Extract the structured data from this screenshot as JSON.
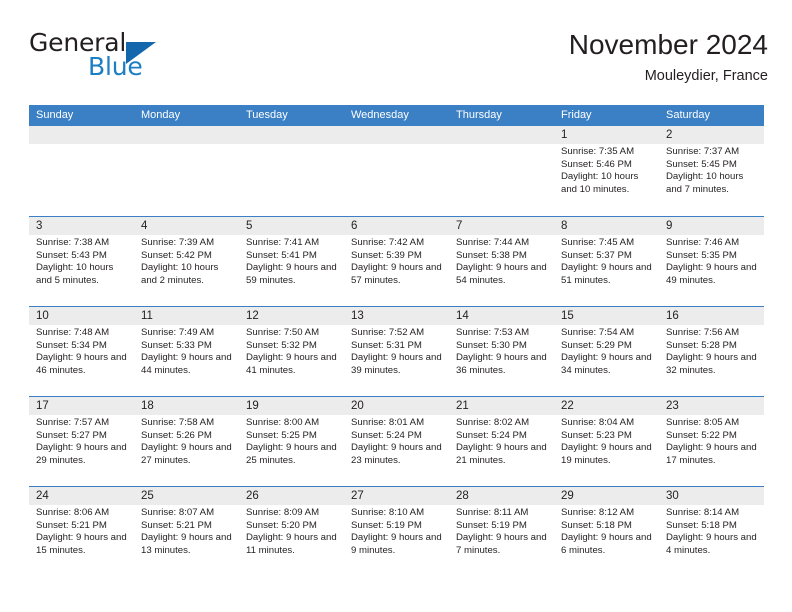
{
  "brand": {
    "name_part1": "General",
    "name_part2": "Blue",
    "accent_color": "#1c7fc4",
    "triangle_color": "#1567ad"
  },
  "header": {
    "title": "November 2024",
    "location": "Mouleydier, France"
  },
  "calendar": {
    "header_color": "#3b7fc4",
    "day_band_color": "#ececec",
    "weekdays": [
      "Sunday",
      "Monday",
      "Tuesday",
      "Wednesday",
      "Thursday",
      "Friday",
      "Saturday"
    ],
    "weeks": [
      [
        {
          "day": "",
          "empty": true
        },
        {
          "day": "",
          "empty": true
        },
        {
          "day": "",
          "empty": true
        },
        {
          "day": "",
          "empty": true
        },
        {
          "day": "",
          "empty": true
        },
        {
          "day": "1",
          "sunrise": "Sunrise: 7:35 AM",
          "sunset": "Sunset: 5:46 PM",
          "daylight": "Daylight: 10 hours and 10 minutes."
        },
        {
          "day": "2",
          "sunrise": "Sunrise: 7:37 AM",
          "sunset": "Sunset: 5:45 PM",
          "daylight": "Daylight: 10 hours and 7 minutes."
        }
      ],
      [
        {
          "day": "3",
          "sunrise": "Sunrise: 7:38 AM",
          "sunset": "Sunset: 5:43 PM",
          "daylight": "Daylight: 10 hours and 5 minutes."
        },
        {
          "day": "4",
          "sunrise": "Sunrise: 7:39 AM",
          "sunset": "Sunset: 5:42 PM",
          "daylight": "Daylight: 10 hours and 2 minutes."
        },
        {
          "day": "5",
          "sunrise": "Sunrise: 7:41 AM",
          "sunset": "Sunset: 5:41 PM",
          "daylight": "Daylight: 9 hours and 59 minutes."
        },
        {
          "day": "6",
          "sunrise": "Sunrise: 7:42 AM",
          "sunset": "Sunset: 5:39 PM",
          "daylight": "Daylight: 9 hours and 57 minutes."
        },
        {
          "day": "7",
          "sunrise": "Sunrise: 7:44 AM",
          "sunset": "Sunset: 5:38 PM",
          "daylight": "Daylight: 9 hours and 54 minutes."
        },
        {
          "day": "8",
          "sunrise": "Sunrise: 7:45 AM",
          "sunset": "Sunset: 5:37 PM",
          "daylight": "Daylight: 9 hours and 51 minutes."
        },
        {
          "day": "9",
          "sunrise": "Sunrise: 7:46 AM",
          "sunset": "Sunset: 5:35 PM",
          "daylight": "Daylight: 9 hours and 49 minutes."
        }
      ],
      [
        {
          "day": "10",
          "sunrise": "Sunrise: 7:48 AM",
          "sunset": "Sunset: 5:34 PM",
          "daylight": "Daylight: 9 hours and 46 minutes."
        },
        {
          "day": "11",
          "sunrise": "Sunrise: 7:49 AM",
          "sunset": "Sunset: 5:33 PM",
          "daylight": "Daylight: 9 hours and 44 minutes."
        },
        {
          "day": "12",
          "sunrise": "Sunrise: 7:50 AM",
          "sunset": "Sunset: 5:32 PM",
          "daylight": "Daylight: 9 hours and 41 minutes."
        },
        {
          "day": "13",
          "sunrise": "Sunrise: 7:52 AM",
          "sunset": "Sunset: 5:31 PM",
          "daylight": "Daylight: 9 hours and 39 minutes."
        },
        {
          "day": "14",
          "sunrise": "Sunrise: 7:53 AM",
          "sunset": "Sunset: 5:30 PM",
          "daylight": "Daylight: 9 hours and 36 minutes."
        },
        {
          "day": "15",
          "sunrise": "Sunrise: 7:54 AM",
          "sunset": "Sunset: 5:29 PM",
          "daylight": "Daylight: 9 hours and 34 minutes."
        },
        {
          "day": "16",
          "sunrise": "Sunrise: 7:56 AM",
          "sunset": "Sunset: 5:28 PM",
          "daylight": "Daylight: 9 hours and 32 minutes."
        }
      ],
      [
        {
          "day": "17",
          "sunrise": "Sunrise: 7:57 AM",
          "sunset": "Sunset: 5:27 PM",
          "daylight": "Daylight: 9 hours and 29 minutes."
        },
        {
          "day": "18",
          "sunrise": "Sunrise: 7:58 AM",
          "sunset": "Sunset: 5:26 PM",
          "daylight": "Daylight: 9 hours and 27 minutes."
        },
        {
          "day": "19",
          "sunrise": "Sunrise: 8:00 AM",
          "sunset": "Sunset: 5:25 PM",
          "daylight": "Daylight: 9 hours and 25 minutes."
        },
        {
          "day": "20",
          "sunrise": "Sunrise: 8:01 AM",
          "sunset": "Sunset: 5:24 PM",
          "daylight": "Daylight: 9 hours and 23 minutes."
        },
        {
          "day": "21",
          "sunrise": "Sunrise: 8:02 AM",
          "sunset": "Sunset: 5:24 PM",
          "daylight": "Daylight: 9 hours and 21 minutes."
        },
        {
          "day": "22",
          "sunrise": "Sunrise: 8:04 AM",
          "sunset": "Sunset: 5:23 PM",
          "daylight": "Daylight: 9 hours and 19 minutes."
        },
        {
          "day": "23",
          "sunrise": "Sunrise: 8:05 AM",
          "sunset": "Sunset: 5:22 PM",
          "daylight": "Daylight: 9 hours and 17 minutes."
        }
      ],
      [
        {
          "day": "24",
          "sunrise": "Sunrise: 8:06 AM",
          "sunset": "Sunset: 5:21 PM",
          "daylight": "Daylight: 9 hours and 15 minutes."
        },
        {
          "day": "25",
          "sunrise": "Sunrise: 8:07 AM",
          "sunset": "Sunset: 5:21 PM",
          "daylight": "Daylight: 9 hours and 13 minutes."
        },
        {
          "day": "26",
          "sunrise": "Sunrise: 8:09 AM",
          "sunset": "Sunset: 5:20 PM",
          "daylight": "Daylight: 9 hours and 11 minutes."
        },
        {
          "day": "27",
          "sunrise": "Sunrise: 8:10 AM",
          "sunset": "Sunset: 5:19 PM",
          "daylight": "Daylight: 9 hours and 9 minutes."
        },
        {
          "day": "28",
          "sunrise": "Sunrise: 8:11 AM",
          "sunset": "Sunset: 5:19 PM",
          "daylight": "Daylight: 9 hours and 7 minutes."
        },
        {
          "day": "29",
          "sunrise": "Sunrise: 8:12 AM",
          "sunset": "Sunset: 5:18 PM",
          "daylight": "Daylight: 9 hours and 6 minutes."
        },
        {
          "day": "30",
          "sunrise": "Sunrise: 8:14 AM",
          "sunset": "Sunset: 5:18 PM",
          "daylight": "Daylight: 9 hours and 4 minutes."
        }
      ]
    ]
  }
}
